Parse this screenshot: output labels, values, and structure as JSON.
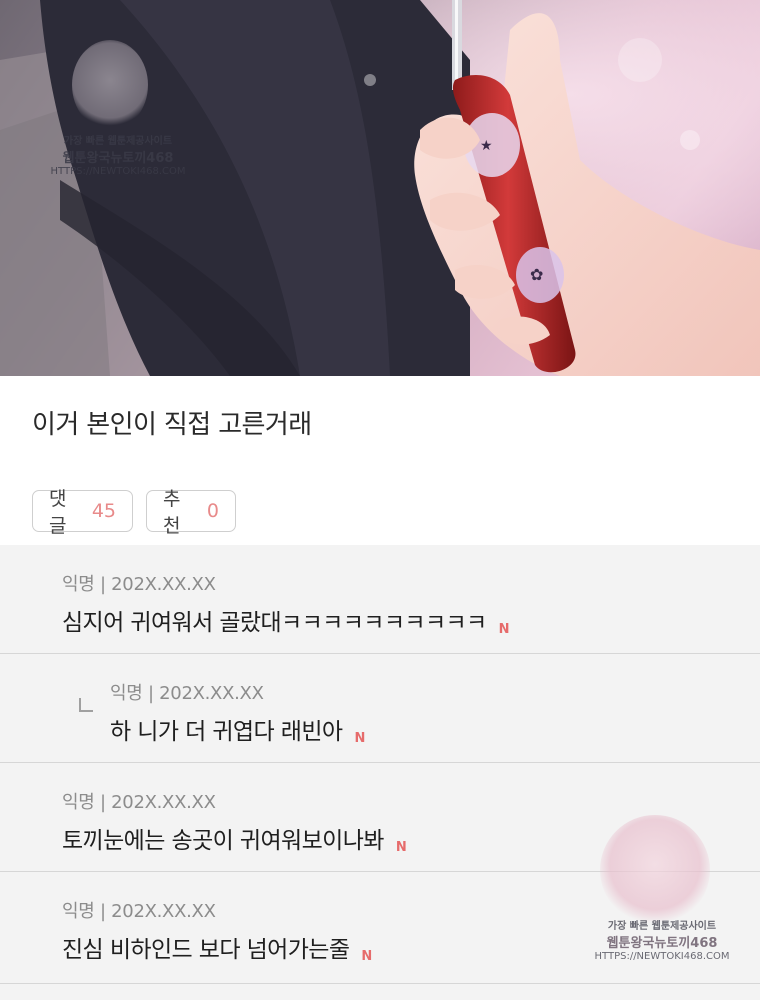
{
  "post": {
    "title": "이거 본인이 직접 고른거래"
  },
  "chips": {
    "comments_label": "댓글",
    "comments_count": "45",
    "recommend_label": "추천",
    "recommend_count": "0"
  },
  "comments": [
    {
      "author": "익명",
      "date": "202X.XX.XX",
      "text": "심지어 귀여워서 골랐대ㅋㅋㅋㅋㅋㅋㅋㅋㅋㅋ",
      "badge": "N",
      "reply": false
    },
    {
      "author": "익명",
      "date": "202X.XX.XX",
      "text": "하 니가 더 귀엽다 래빈아",
      "badge": "N",
      "reply": true
    },
    {
      "author": "익명",
      "date": "202X.XX.XX",
      "text": "토끼눈에는 송곳이 귀여워보이나봐",
      "badge": "N",
      "reply": false
    },
    {
      "author": "익명",
      "date": "202X.XX.XX",
      "text": "진심 비하인드 보다 넘어가는줄",
      "badge": "N",
      "reply": false
    }
  ],
  "watermark": {
    "line1": "가장 빠른 웹툰제공사이트",
    "line2": "웹툰왕국뉴토끼468",
    "line3": "HTTPS://NEWTOKI468.COM"
  },
  "colors": {
    "count_accent": "#e88a8a",
    "new_badge": "#e66b6b",
    "comment_bg": "#f3f3f3"
  }
}
